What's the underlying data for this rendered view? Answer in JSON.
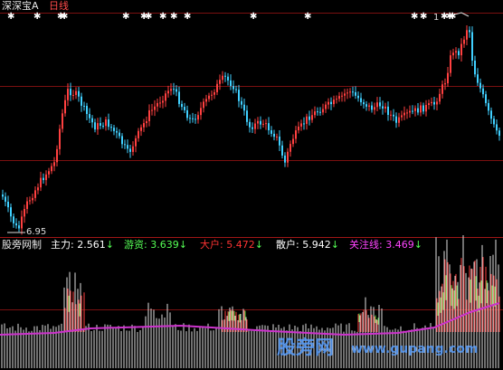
{
  "header": {
    "title": "深深宝A",
    "period": "日线",
    "title_color": "#e8e8e8",
    "period_color": "#ff4a4a"
  },
  "price_panel": {
    "low_label": "6.95",
    "marker_label": "1"
  },
  "indicator": {
    "name": "股旁网制",
    "items": [
      {
        "label": "主力:",
        "value": "2.561",
        "arrow": "↓",
        "color": "#ffffff"
      },
      {
        "label": "游资:",
        "value": "3.639",
        "arrow": "↓",
        "color": "#55ff55"
      },
      {
        "label": "大户:",
        "value": "5.472",
        "arrow": "↓",
        "color": "#ff3333"
      },
      {
        "label": "散户:",
        "value": "5.942",
        "arrow": "↓",
        "color": "#ffffff"
      },
      {
        "label": "关注线:",
        "value": "3.469",
        "arrow": "↓",
        "color": "#ff44ff"
      }
    ]
  },
  "watermark": {
    "cn": "股旁网",
    "url": "www.gupang.com"
  },
  "colors": {
    "background": "#000000",
    "up": "#ff4040",
    "down": "#40d0ff",
    "grid": "#7a1010",
    "line": "#cc33cc",
    "green": "#44dd44"
  }
}
